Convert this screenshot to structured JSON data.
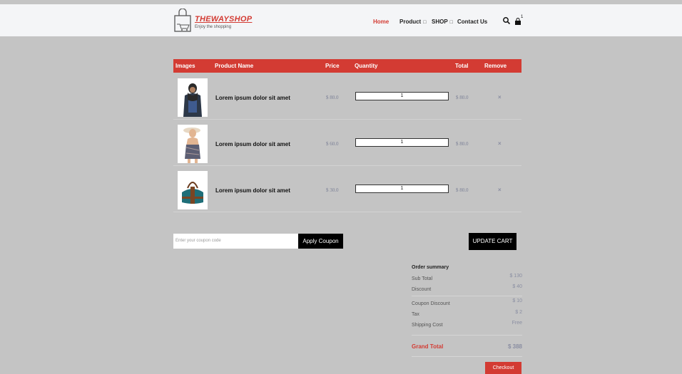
{
  "header": {
    "logo": {
      "name": "THEWAYSHOP",
      "tagline": "Enjoy the shopping"
    },
    "nav": [
      {
        "label": "Home",
        "active": true,
        "has_dropdown": false
      },
      {
        "label": "Product",
        "active": false,
        "has_dropdown": true
      },
      {
        "label": "SHOP",
        "active": false,
        "has_dropdown": true
      },
      {
        "label": "Contact Us",
        "active": false,
        "has_dropdown": false
      }
    ],
    "dropdown_glyph": "□",
    "icons": [
      "search-icon",
      "shopping-bag-icon"
    ],
    "cart_count": "1"
  },
  "table": {
    "headers": {
      "images": "Images",
      "product_name": "Product Name",
      "price": "Price",
      "quantity": "Quantity",
      "total": "Total",
      "remove": "Remove"
    },
    "rows": [
      {
        "name": "Lorem ipsum dolor sit amet",
        "price": "$ 80.0",
        "quantity": "1",
        "total": "$ 80.0",
        "remove": "×",
        "image": "man-in-scarf"
      },
      {
        "name": "Lorem ipsum dolor sit amet",
        "price": "$ 60.0",
        "quantity": "1",
        "total": "$ 80.0",
        "remove": "×",
        "image": "woman-in-hat"
      },
      {
        "name": "Lorem ipsum dolor sit amet",
        "price": "$ 30.0",
        "quantity": "1",
        "total": "$ 80.0",
        "remove": "×",
        "image": "handbag"
      }
    ]
  },
  "coupon": {
    "placeholder": "Enter your coupon code",
    "apply_label": "Apply Coupon",
    "update_label": "UPDATE CART"
  },
  "summary": {
    "title": "Order summary",
    "sub_total": {
      "label": "Sub Total",
      "value": "$ 130"
    },
    "discount": {
      "label": "Discount",
      "value": "$ 40"
    },
    "coupon_discount": {
      "label": "Coupon Discount",
      "value": "$ 10"
    },
    "tax": {
      "label": "Tax",
      "value": "$ 2"
    },
    "shipping": {
      "label": "Shipping Cost",
      "value": "Free"
    },
    "grand_total": {
      "label": "Grand Total",
      "value": "$ 388"
    }
  },
  "checkout_label": "Checkout",
  "colors": {
    "accent": "#d33b33",
    "background": "#c4c4c4",
    "header_bg": "#f4f5f7",
    "muted_value": "#8a8ea2"
  }
}
